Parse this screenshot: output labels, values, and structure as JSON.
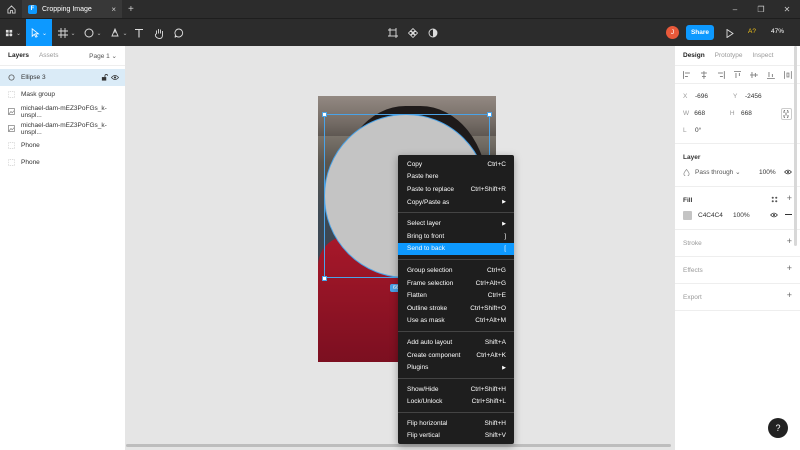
{
  "titlebar": {
    "tab_title": "Cropping Image",
    "tab_logo_text": "F",
    "close_glyph": "×",
    "plus_glyph": "+",
    "minimize_glyph": "–",
    "maximize_glyph": "❐",
    "window_close_glyph": "✕"
  },
  "toolbar": {
    "share_label": "Share",
    "avatar_letter": "J",
    "badge_text": "A?",
    "zoom_label": "47%",
    "accent": "#0d99ff"
  },
  "layers_panel": {
    "tabs": [
      "Layers",
      "Assets"
    ],
    "page_label": "Page 1 ⌄",
    "items": [
      {
        "label": "Ellipse 3",
        "icon": "ellipse-icon",
        "selected": true
      },
      {
        "label": "Mask group",
        "icon": "mask-icon"
      },
      {
        "label": "michael-dam-mEZ3PoFGs_k-unspl...",
        "icon": "image-icon"
      },
      {
        "label": "michael-dam-mEZ3PoFGs_k-unspl...",
        "icon": "image-icon"
      },
      {
        "label": "Phone",
        "icon": "frame-icon"
      },
      {
        "label": "Phone",
        "icon": "frame-icon"
      }
    ],
    "lock_glyph": "🔓",
    "eye_glyph": "👁"
  },
  "canvas": {
    "size_badge": "668"
  },
  "context_menu": {
    "groups": [
      [
        {
          "label": "Copy",
          "shortcut": "Ctrl+C"
        },
        {
          "label": "Paste here",
          "shortcut": ""
        },
        {
          "label": "Paste to replace",
          "shortcut": "Ctrl+Shift+R"
        },
        {
          "label": "Copy/Paste as",
          "shortcut": "▶"
        }
      ],
      [
        {
          "label": "Select layer",
          "shortcut": "▶"
        },
        {
          "label": "Bring to front",
          "shortcut": "]"
        },
        {
          "label": "Send to back",
          "shortcut": "[",
          "highlighted": true
        }
      ],
      [
        {
          "label": "Group selection",
          "shortcut": "Ctrl+G"
        },
        {
          "label": "Frame selection",
          "shortcut": "Ctrl+Alt+G"
        },
        {
          "label": "Flatten",
          "shortcut": "Ctrl+E"
        },
        {
          "label": "Outline stroke",
          "shortcut": "Ctrl+Shift+O"
        },
        {
          "label": "Use as mask",
          "shortcut": "Ctrl+Alt+M"
        }
      ],
      [
        {
          "label": "Add auto layout",
          "shortcut": "Shift+A"
        },
        {
          "label": "Create component",
          "shortcut": "Ctrl+Alt+K"
        },
        {
          "label": "Plugins",
          "shortcut": "▶"
        }
      ],
      [
        {
          "label": "Show/Hide",
          "shortcut": "Ctrl+Shift+H"
        },
        {
          "label": "Lock/Unlock",
          "shortcut": "Ctrl+Shift+L"
        }
      ],
      [
        {
          "label": "Flip horizontal",
          "shortcut": "Shift+H"
        },
        {
          "label": "Flip vertical",
          "shortcut": "Shift+V"
        }
      ]
    ]
  },
  "design_panel": {
    "tabs": [
      "Design",
      "Prototype",
      "Inspect"
    ],
    "x_label": "X",
    "x_value": "-696",
    "y_label": "Y",
    "y_value": "-2456",
    "w_label": "W",
    "w_value": "668",
    "h_label": "H",
    "h_value": "668",
    "r_label": "L",
    "r_value": "0°",
    "layer_title": "Layer",
    "blend_mode": "Pass through ⌄",
    "opacity": "100%",
    "fill_title": "Fill",
    "fill_hex": "C4C4C4",
    "fill_opacity": "100%",
    "fill_color": "#c4c4c4",
    "stroke_title": "Stroke",
    "effects_title": "Effects",
    "export_title": "Export",
    "add_glyph": "+",
    "help_glyph": "?"
  }
}
